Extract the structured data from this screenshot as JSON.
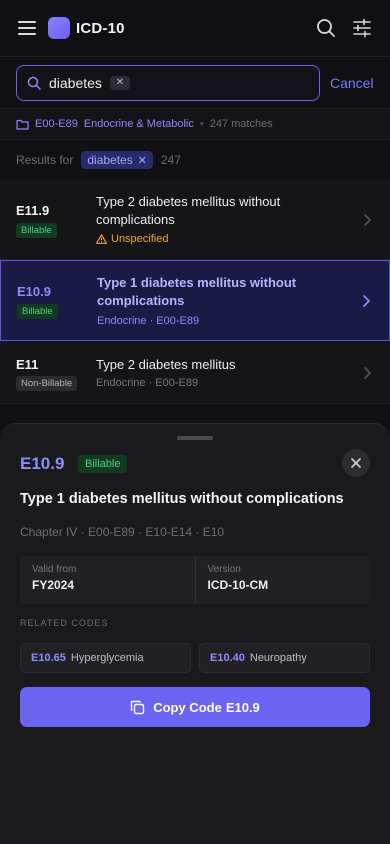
{
  "app": {
    "title": "ICD-10"
  },
  "search": {
    "query": "diabetes",
    "clear_label": "✕",
    "cancel_label": "Cancel"
  },
  "chapter": {
    "range": "E00-E89",
    "name": "Endocrine & Metabolic",
    "separator": "•",
    "matches": "247 matches"
  },
  "results_header": {
    "label": "Results for",
    "term": "diabetes",
    "term_remove": "✕",
    "count": "247"
  },
  "results": [
    {
      "code": "E11.9",
      "status": "Billable",
      "title": "Type 2 diabetes mellitus without complications",
      "warning": "Unspecified"
    },
    {
      "code": "E10.9",
      "status": "Billable",
      "title": "Type 1 diabetes mellitus without complications",
      "meta": "Endocrine · E00-E89",
      "selected": true
    },
    {
      "code": "E11",
      "status": "Non-Billable",
      "title": "Type 2 diabetes mellitus",
      "meta": "Endocrine · E00-E89"
    }
  ],
  "detail": {
    "code": "E10.9",
    "status": "Billable",
    "title": "Type 1 diabetes mellitus without complications",
    "hierarchy": "Chapter IV · E00-E89 · E10-E14 · E10",
    "valid_label": "Valid from",
    "valid_value": "FY2024",
    "version_label": "Version",
    "version_value": "ICD-10-CM",
    "related_label": "RELATED CODES",
    "related": [
      {
        "code": "E10.65",
        "name": "Hyperglycemia"
      },
      {
        "code": "E10.40",
        "name": "Neuropathy"
      }
    ],
    "copy_label": "Copy Code",
    "copy_code": "E10.9"
  },
  "colors": {
    "accent": "#6b63f2",
    "billable": "#4fd07a",
    "warning": "#f0a63a",
    "background": "#101012"
  },
  "icons": [
    "menu-icon",
    "search-icon",
    "filter-sliders-icon",
    "folder-icon",
    "chevron-right-icon",
    "warning-icon",
    "close-icon",
    "copy-icon"
  ]
}
